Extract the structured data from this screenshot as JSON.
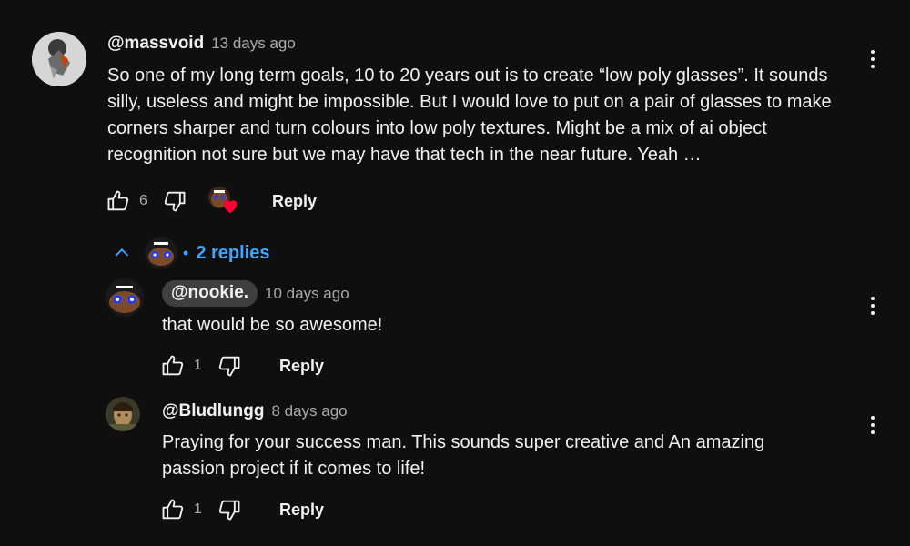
{
  "comment": {
    "handle": "@massvoid",
    "time": "13 days ago",
    "text": "So one of my long term goals, 10 to 20 years out is to create “low poly glasses”. It sounds silly, useless and might be impossible. But I would love to put on a pair of glasses to make corners sharper and turn colours into low poly textures. Might be a mix of ai object recognition not sure but we may have that tech in the near future. Yeah …",
    "likes": "6",
    "reply_label": "Reply"
  },
  "replies_toggle": {
    "dot": "•",
    "label": "2 replies"
  },
  "replies": [
    {
      "handle": "@nookie.",
      "time": "10 days ago",
      "text": "that would be so awesome!",
      "likes": "1",
      "reply_label": "Reply"
    },
    {
      "handle": "@Bludlungg",
      "time": "8 days ago",
      "text": "Praying for your success man. This sounds super creative and An amazing passion project if it comes to life!",
      "likes": "1",
      "reply_label": "Reply"
    }
  ],
  "colors": {
    "background": "#0f0f0f",
    "link_blue": "#3ea6ff",
    "heart_red": "#ff0033",
    "pill_gray": "#3f3f3f"
  },
  "icons": [
    "thumb-up-icon",
    "thumb-down-icon",
    "heart-icon",
    "more-vert-icon",
    "chevron-up-icon"
  ]
}
